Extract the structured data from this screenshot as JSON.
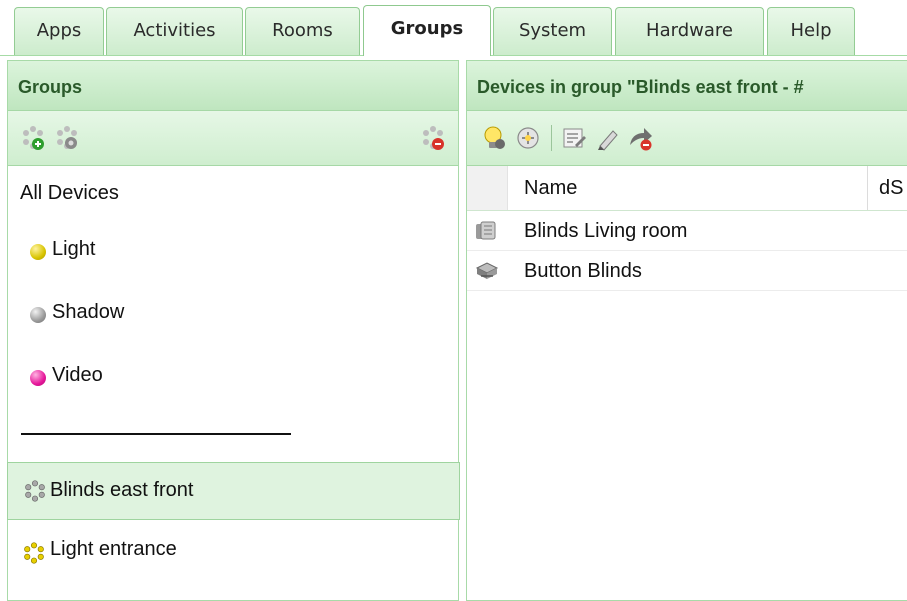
{
  "tabs": [
    {
      "label": "Apps"
    },
    {
      "label": "Activities"
    },
    {
      "label": "Rooms"
    },
    {
      "label": "Groups",
      "active": true
    },
    {
      "label": "System"
    },
    {
      "label": "Hardware"
    },
    {
      "label": "Help"
    }
  ],
  "left_panel": {
    "title": "Groups",
    "toolbar": [
      "add-group-icon",
      "edit-group-icon",
      "delete-group-icon"
    ],
    "items": [
      {
        "label": "All Devices"
      },
      {
        "label": "Light",
        "color": "#d8c400"
      },
      {
        "label": "Shadow",
        "color": "#9a9a9a"
      },
      {
        "label": "Video",
        "color": "#e6179a"
      },
      {
        "label": "Blinds east front",
        "selected": true
      },
      {
        "label": "Light entrance"
      }
    ]
  },
  "right_panel": {
    "title": "Devices in group \"Blinds east front - #",
    "toolbar": [
      "lightbulb-icon",
      "gear-puzzle-icon",
      "edit-list-icon",
      "pencil-icon",
      "arrow-remove-icon"
    ],
    "columns": [
      "Name",
      "dS"
    ],
    "rows": [
      {
        "name": "Blinds Living room",
        "icon": "blind-module-icon"
      },
      {
        "name": "Button Blinds",
        "icon": "button-device-icon"
      }
    ]
  },
  "colors": {
    "accent_green": "#a8daa8",
    "header_text": "#2a5a2a",
    "light": "#d8c400",
    "shadow": "#9a9a9a",
    "video": "#e6179a"
  }
}
